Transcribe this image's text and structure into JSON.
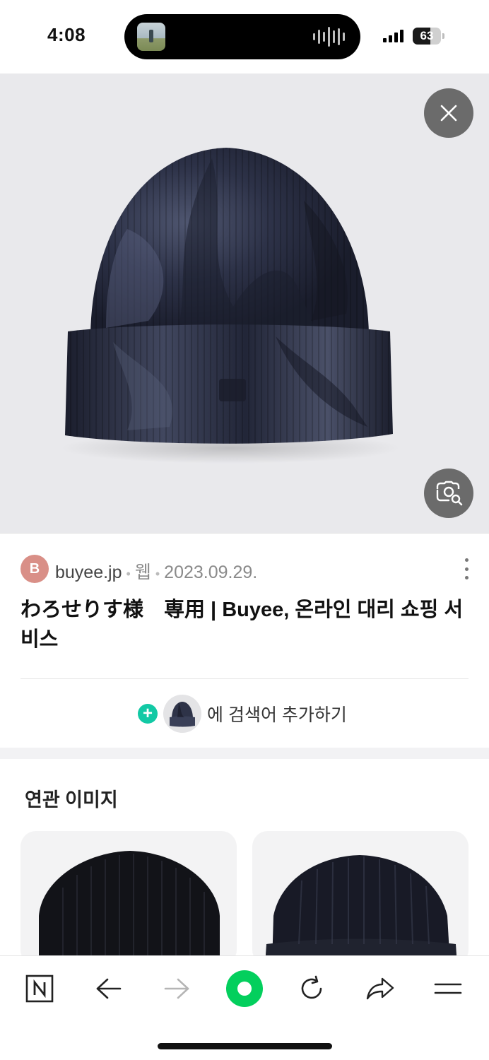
{
  "status_bar": {
    "time": "4:08",
    "battery_percent": "63",
    "battery_level": 0.63
  },
  "hero": {
    "close_icon": "close-icon",
    "lens_icon": "image-search-icon"
  },
  "result": {
    "source_initial": "B",
    "source_domain": "buyee.jp",
    "source_type": "웹",
    "date": "2023.09.29.",
    "title": "わろせりす様　専用 | Buyee, 온라인 대리 쇼핑 서비스"
  },
  "add_search": {
    "label": "에 검색어 추가하기"
  },
  "related": {
    "title": "연관 이미지"
  },
  "toolbar": {
    "items": [
      "naver-home-icon",
      "back-arrow-icon",
      "forward-arrow-icon",
      "green-dot-button",
      "refresh-icon",
      "share-icon",
      "menu-icon"
    ]
  },
  "colors": {
    "accent_green": "#03cf5d",
    "plus_teal": "#12c9a5",
    "avatar": "#d98f87",
    "overlay_button": "#6b6b6b"
  }
}
